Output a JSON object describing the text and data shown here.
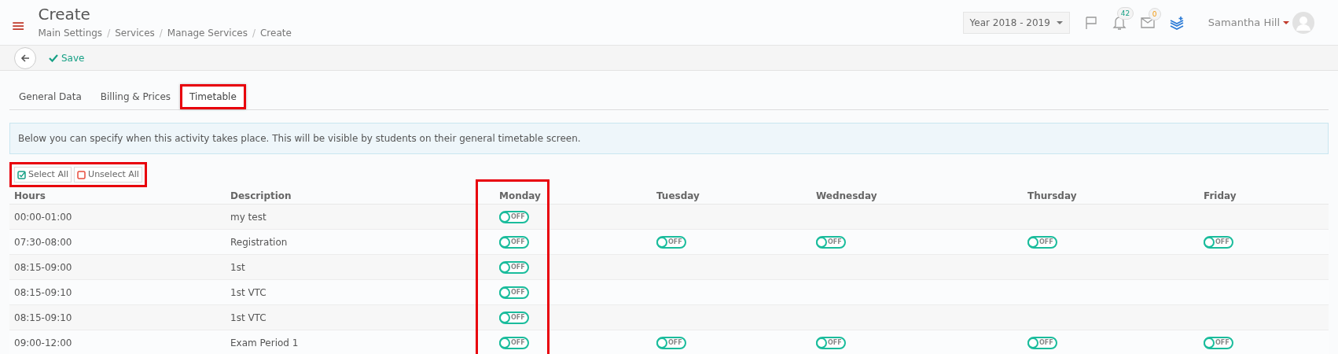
{
  "header": {
    "menu_icon": "≡",
    "title": "Create",
    "breadcrumb": [
      "Main Settings",
      "Services",
      "Manage Services",
      "Create"
    ],
    "breadcrumb_separator": "/",
    "year_select": "Year 2018 - 2019",
    "notifications_badge": "42",
    "messages_badge": "0",
    "user_name": "Samantha Hill"
  },
  "toolbar": {
    "save_label": "Save"
  },
  "tabs": [
    {
      "label": "General Data",
      "selected": false,
      "highlighted": false
    },
    {
      "label": "Billing & Prices",
      "selected": false,
      "highlighted": false
    },
    {
      "label": "Timetable",
      "selected": true,
      "highlighted": true
    }
  ],
  "info": "Below you can specify when this activity takes place. This will be visible by students on their general timetable screen.",
  "selection_buttons": {
    "highlighted": true,
    "select_all": "Select All",
    "unselect_all": "Unselect All"
  },
  "table": {
    "columns": [
      {
        "label": "Hours",
        "highlighted": false
      },
      {
        "label": "Description",
        "highlighted": false
      },
      {
        "label": "Monday",
        "highlighted": true
      },
      {
        "label": "Tuesday",
        "highlighted": false
      },
      {
        "label": "Wednesday",
        "highlighted": false
      },
      {
        "label": "Thursday",
        "highlighted": false
      },
      {
        "label": "Friday",
        "highlighted": false
      }
    ],
    "rows": [
      {
        "hours": "00:00-01:00",
        "description": "my test",
        "days": [
          {
            "kind": "toggle",
            "on": false,
            "label": "OFF"
          },
          {
            "kind": "empty"
          },
          {
            "kind": "empty"
          },
          {
            "kind": "empty"
          },
          {
            "kind": "empty"
          }
        ]
      },
      {
        "hours": "07:30-08:00",
        "description": "Registration",
        "days": [
          {
            "kind": "toggle",
            "on": false,
            "label": "OFF"
          },
          {
            "kind": "toggle",
            "on": false,
            "label": "OFF"
          },
          {
            "kind": "toggle",
            "on": false,
            "label": "OFF"
          },
          {
            "kind": "toggle",
            "on": false,
            "label": "OFF"
          },
          {
            "kind": "toggle",
            "on": false,
            "label": "OFF"
          }
        ]
      },
      {
        "hours": "08:15-09:00",
        "description": "1st",
        "days": [
          {
            "kind": "toggle",
            "on": false,
            "label": "OFF"
          },
          {
            "kind": "empty"
          },
          {
            "kind": "empty"
          },
          {
            "kind": "empty"
          },
          {
            "kind": "empty"
          }
        ]
      },
      {
        "hours": "08:15-09:10",
        "description": "1st VTC",
        "days": [
          {
            "kind": "toggle",
            "on": false,
            "label": "OFF"
          },
          {
            "kind": "empty"
          },
          {
            "kind": "empty"
          },
          {
            "kind": "empty"
          },
          {
            "kind": "empty"
          }
        ]
      },
      {
        "hours": "08:15-09:10",
        "description": "1st VTC",
        "days": [
          {
            "kind": "toggle",
            "on": false,
            "label": "OFF"
          },
          {
            "kind": "empty"
          },
          {
            "kind": "empty"
          },
          {
            "kind": "empty"
          },
          {
            "kind": "empty"
          }
        ]
      },
      {
        "hours": "09:00-12:00",
        "description": "Exam Period 1",
        "days": [
          {
            "kind": "toggle",
            "on": false,
            "label": "OFF"
          },
          {
            "kind": "toggle",
            "on": false,
            "label": "OFF"
          },
          {
            "kind": "toggle",
            "on": false,
            "label": "OFF"
          },
          {
            "kind": "toggle",
            "on": false,
            "label": "OFF"
          },
          {
            "kind": "toggle",
            "on": false,
            "label": "OFF"
          }
        ]
      }
    ]
  }
}
